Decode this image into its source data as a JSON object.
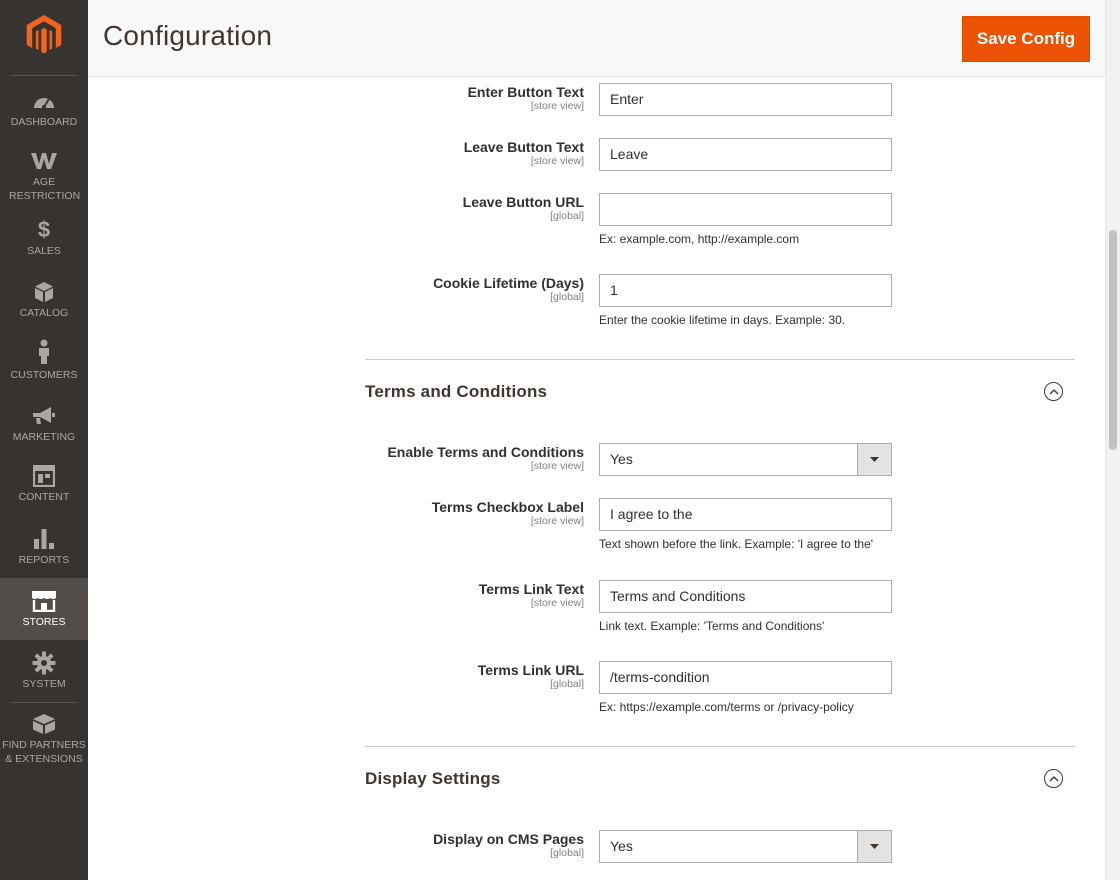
{
  "app": {
    "logo_icon": "magento-logo",
    "accent_color": "#eb5202"
  },
  "sidebar": {
    "items": [
      {
        "label": "DASHBOARD",
        "icon": "speedometer-icon"
      },
      {
        "label": "AGE RESTRICTION",
        "icon": "w-logo-icon"
      },
      {
        "label": "SALES",
        "icon": "dollar-icon"
      },
      {
        "label": "CATALOG",
        "icon": "cube-icon"
      },
      {
        "label": "CUSTOMERS",
        "icon": "person-icon"
      },
      {
        "label": "MARKETING",
        "icon": "megaphone-icon"
      },
      {
        "label": "CONTENT",
        "icon": "layout-icon"
      },
      {
        "label": "REPORTS",
        "icon": "bar-chart-icon"
      },
      {
        "label": "STORES",
        "icon": "storefront-icon",
        "active": true
      },
      {
        "label": "SYSTEM",
        "icon": "gear-icon"
      },
      {
        "label": "FIND PARTNERS & EXTENSIONS",
        "icon": "blocks-icon"
      }
    ]
  },
  "header": {
    "title": "Configuration",
    "save_label": "Save Config"
  },
  "fields": {
    "enter_text": {
      "label": "Enter Button Text",
      "scope": "[store view]",
      "value": "Enter"
    },
    "leave_text": {
      "label": "Leave Button Text",
      "scope": "[store view]",
      "value": "Leave"
    },
    "leave_url": {
      "label": "Leave Button URL",
      "scope": "[global]",
      "value": "",
      "note": "Ex: example.com, http://example.com"
    },
    "cookie_lifetime": {
      "label": "Cookie Lifetime (Days)",
      "scope": "[global]",
      "value": "1",
      "note": "Enter the cookie lifetime in days. Example: 30."
    },
    "enable_terms": {
      "label": "Enable Terms and Conditions",
      "scope": "[store view]",
      "value": "Yes"
    },
    "terms_checkbox_label": {
      "label": "Terms Checkbox Label",
      "scope": "[store view]",
      "value": "I agree to the",
      "note": "Text shown before the link. Example: 'I agree to the'"
    },
    "terms_link_text": {
      "label": "Terms Link Text",
      "scope": "[store view]",
      "value": "Terms and Conditions",
      "note": "Link text. Example: 'Terms and Conditions'"
    },
    "terms_link_url": {
      "label": "Terms Link URL",
      "scope": "[global]",
      "value": "/terms-condition",
      "note": "Ex: https://example.com/terms or /privacy-policy"
    },
    "display_cms": {
      "label": "Display on CMS Pages",
      "scope": "[global]",
      "value": "Yes"
    }
  },
  "sections": {
    "terms": {
      "title": "Terms and Conditions",
      "icon": "chevron-up-circle-icon"
    },
    "display": {
      "title": "Display Settings",
      "icon": "chevron-up-circle-icon"
    }
  }
}
